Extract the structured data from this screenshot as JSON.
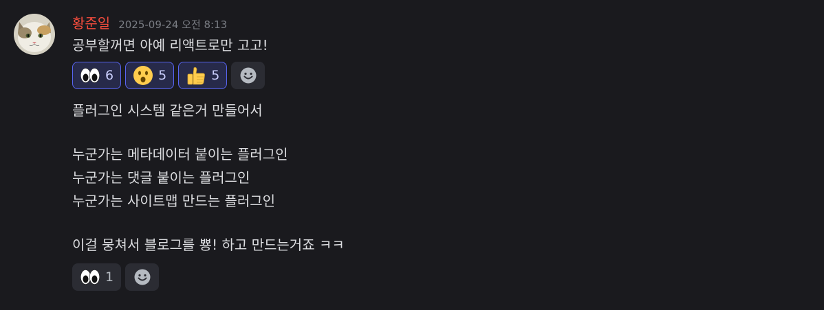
{
  "message": {
    "author": "황준일",
    "timestamp": "2025-09-24 오전 8:13",
    "lines": [
      "공부할꺼면 아예 리액트로만 고고!",
      "플러그인 시스템 같은거 만들어서",
      "누군가는 메타데이터 붙이는 플러그인",
      "누군가는 댓글 붙이는 플러그인",
      "누군가는 사이트맵 만드는 플러그인",
      "이걸 뭉쳐서 블로그를 뿅! 하고 만드는거죠 ㅋㅋ"
    ]
  },
  "reactions_top": [
    {
      "emoji": "eyes-icon",
      "count": "6",
      "active": true
    },
    {
      "emoji": "hushed-face-icon",
      "count": "5",
      "active": true
    },
    {
      "emoji": "thumbs-up-icon",
      "count": "5",
      "active": true
    }
  ],
  "reactions_bottom": [
    {
      "emoji": "eyes-icon",
      "count": "1",
      "active": false
    }
  ],
  "colors": {
    "background": "#1a1a1e",
    "username": "#f24c3d",
    "timestamp": "#7a7d84",
    "reaction_active_bg": "#272a4a",
    "reaction_active_border": "#5865f2",
    "reaction_bg": "#2b2c33"
  }
}
